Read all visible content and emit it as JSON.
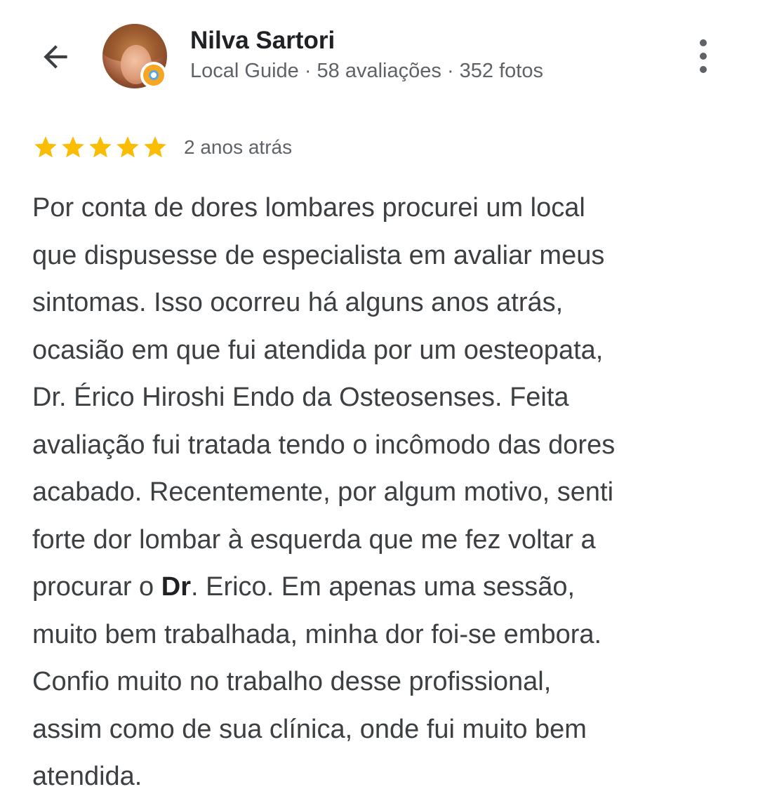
{
  "user": {
    "name": "Nilva Sartori",
    "meta": "Local Guide · 58 avaliações · 352 fotos",
    "badge_icon": "local-guide-icon"
  },
  "review": {
    "rating": 5,
    "rating_max": 5,
    "star_color": "#fbbc04",
    "time_ago": "2 anos atrás",
    "lines": [
      "Por conta de dores lombares procurei um local",
      "que dispusesse de especialista em avaliar meus",
      "sintomas. Isso ocorreu há alguns anos atrás,",
      "ocasião em que fui atendida por um oesteopata,",
      "Dr. Érico Hiroshi Endo da Osteosenses. Feita",
      "avaliação fui tratada tendo o incômodo das dores",
      "acabado. Recentemente, por algum motivo, senti",
      "forte dor lombar à esquerda que me fez voltar a"
    ],
    "line9": {
      "before": "procurar o ",
      "bold": "Dr",
      "after": ". Erico. Em apenas uma sessão,"
    },
    "lines_end": [
      "muito bem trabalhada, minha dor foi-se embora.",
      "Confio muito no trabalho desse profissional,",
      "assim como de sua clínica, onde fui muito bem",
      "atendida."
    ]
  },
  "icons": {
    "back": "arrow-back-icon",
    "more": "more-vertical-icon",
    "star": "star-icon"
  }
}
